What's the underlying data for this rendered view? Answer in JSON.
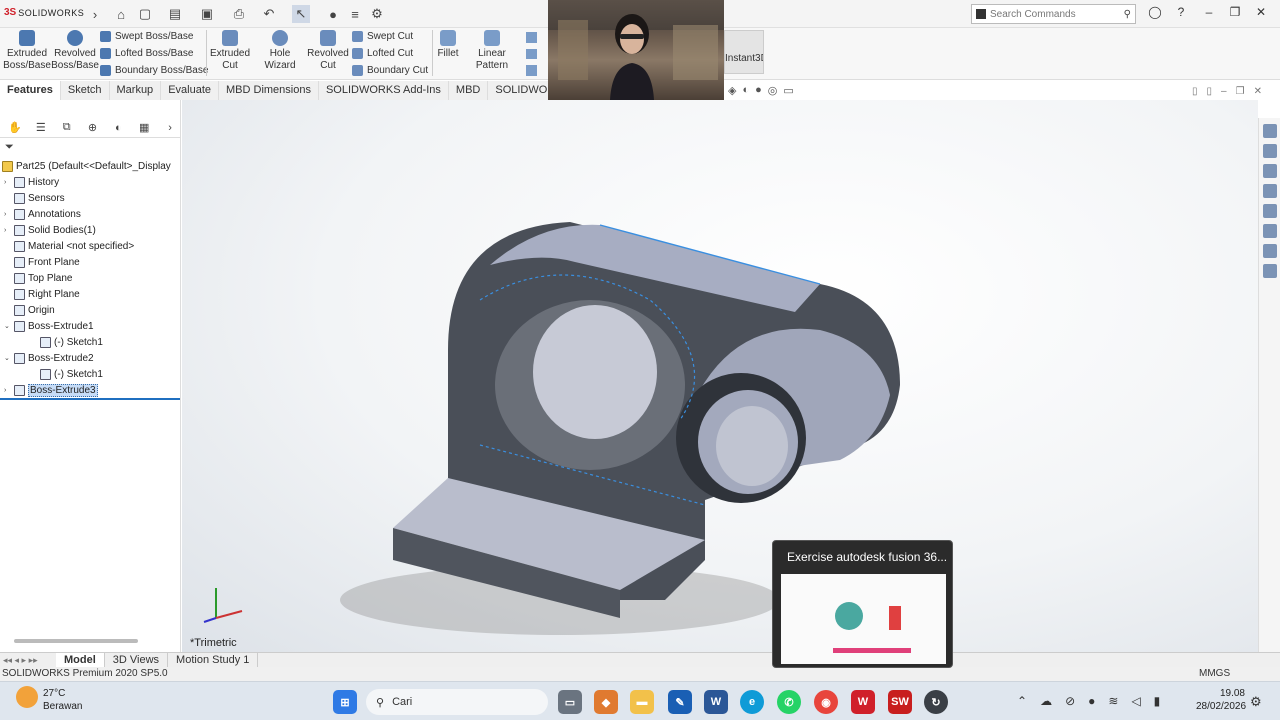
{
  "app": {
    "brand": "SOLIDWORKS",
    "brand_prefix": "3S"
  },
  "search": {
    "placeholder": "Search Commands"
  },
  "ribbon": {
    "extruded_boss": "Extruded Boss/Base",
    "revolved_boss": "Revolved Boss/Base",
    "swept_boss": "Swept Boss/Base",
    "lofted_boss": "Lofted Boss/Base",
    "boundary_boss": "Boundary Boss/Base",
    "extruded_cut": "Extruded Cut",
    "hole_wizard": "Hole Wizard",
    "revolved_cut": "Revolved Cut",
    "swept_cut": "Swept Cut",
    "lofted_cut": "Lofted Cut",
    "boundary_cut": "Boundary Cut",
    "fillet": "Fillet",
    "linear_pattern": "Linear Pattern",
    "instant3d": "Instant3D"
  },
  "tabs": [
    "Features",
    "Sketch",
    "Markup",
    "Evaluate",
    "MBD Dimensions",
    "SOLIDWORKS Add-Ins",
    "MBD",
    "SOLIDWORKS Inspection"
  ],
  "tree": {
    "root": "Part25  (Default<<Default>_Display",
    "items": [
      {
        "label": "History",
        "arrow": "›",
        "indent": 0
      },
      {
        "label": "Sensors",
        "arrow": "",
        "indent": 0
      },
      {
        "label": "Annotations",
        "arrow": "›",
        "indent": 0
      },
      {
        "label": "Solid Bodies(1)",
        "arrow": "›",
        "indent": 0
      },
      {
        "label": "Material <not specified>",
        "arrow": "",
        "indent": 0
      },
      {
        "label": "Front Plane",
        "arrow": "",
        "indent": 0
      },
      {
        "label": "Top Plane",
        "arrow": "",
        "indent": 0
      },
      {
        "label": "Right Plane",
        "arrow": "",
        "indent": 0
      },
      {
        "label": "Origin",
        "arrow": "",
        "indent": 0
      },
      {
        "label": "Boss-Extrude1",
        "arrow": "⌄",
        "indent": 0
      },
      {
        "label": "(-) Sketch1",
        "arrow": "",
        "indent": 1
      },
      {
        "label": "Boss-Extrude2",
        "arrow": "⌄",
        "indent": 0
      },
      {
        "label": "(-) Sketch1",
        "arrow": "",
        "indent": 1
      },
      {
        "label": "Boss-Extrude3",
        "arrow": "›",
        "indent": 0,
        "selected": true
      }
    ]
  },
  "viewport": {
    "view_label": "*Trimetric"
  },
  "bottom_tabs": [
    "Model",
    "3D Views",
    "Motion Study 1"
  ],
  "status": {
    "left": "SOLIDWORKS Premium 2020 SP5.0",
    "units": "MMGS"
  },
  "popup": {
    "title": "Exercise autodesk fusion 36..."
  },
  "taskbar": {
    "weather_temp": "27°C",
    "weather_desc": "Berawan",
    "search_label": "Cari",
    "time": "19.08",
    "date": "28/02/2026"
  },
  "colors": {
    "accent": "#1f6fc0",
    "brand_red": "#d0202a",
    "model": "#9aa2b8",
    "model_dark": "#4a4f58"
  }
}
